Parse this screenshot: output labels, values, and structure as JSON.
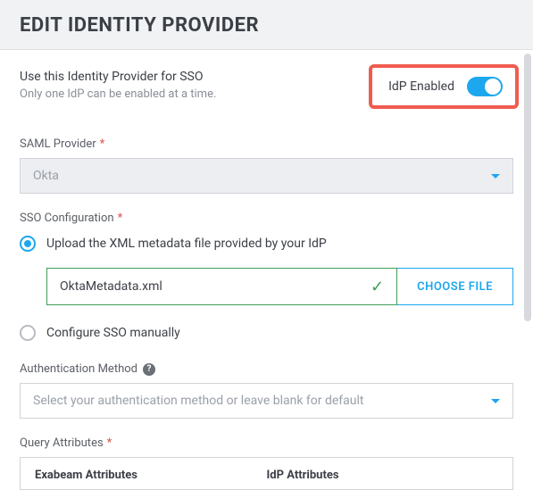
{
  "header": {
    "title": "EDIT IDENTITY PROVIDER"
  },
  "sso": {
    "line1": "Use this Identity Provider for SSO",
    "line2": "Only one IdP can be enabled at a time.",
    "toggle_label": "IdP Enabled",
    "toggle_on": true
  },
  "saml": {
    "label": "SAML Provider",
    "required": "*",
    "value": "Okta"
  },
  "ssoconfig": {
    "label": "SSO Configuration",
    "required": "*",
    "option_upload": "Upload the XML metadata file provided by your IdP",
    "option_manual": "Configure SSO manually",
    "file_name": "OktaMetadata.xml",
    "choose_file": "CHOOSE FILE"
  },
  "auth": {
    "label": "Authentication Method",
    "placeholder": "Select your authentication method or leave blank for default"
  },
  "query": {
    "label": "Query Attributes",
    "required": "*",
    "col1": "Exabeam Attributes",
    "col2": "IdP Attributes"
  }
}
